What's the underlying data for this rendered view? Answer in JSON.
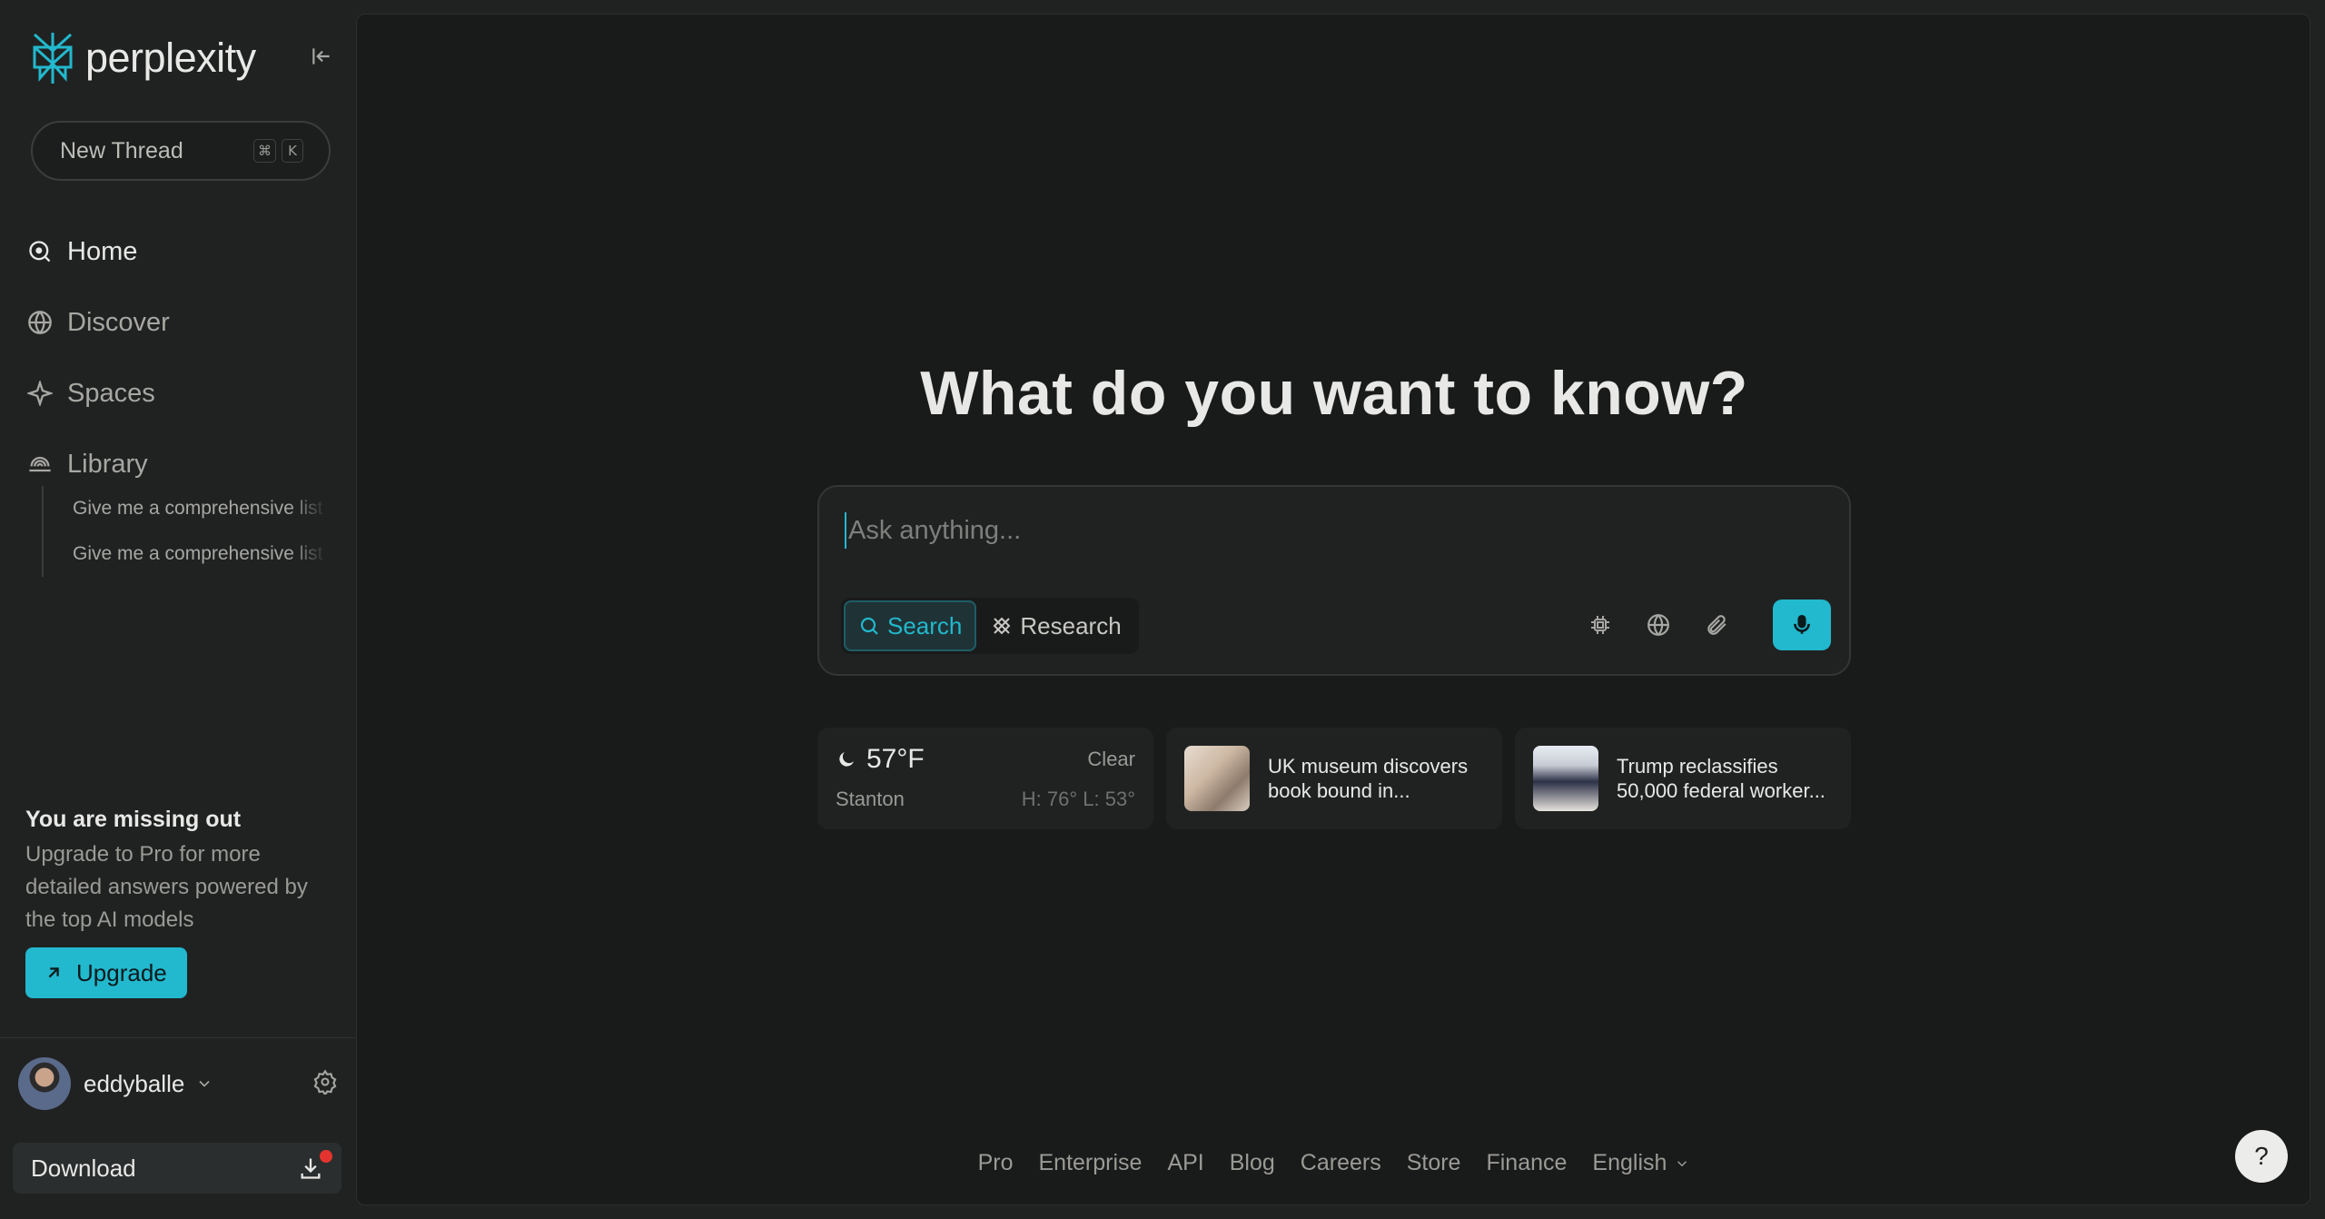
{
  "brand": {
    "name": "perplexity",
    "accent": "#22b8cd"
  },
  "sidebar": {
    "new_thread": {
      "label": "New Thread",
      "shortcut": [
        "⌘",
        "K"
      ]
    },
    "nav": [
      {
        "label": "Home",
        "icon": "search-icon",
        "active": true
      },
      {
        "label": "Discover",
        "icon": "globe-icon"
      },
      {
        "label": "Spaces",
        "icon": "sparkle-icon"
      },
      {
        "label": "Library",
        "icon": "library-icon"
      }
    ],
    "library_items": [
      "Give me a comprehensive list",
      "Give me a comprehensive list"
    ],
    "promo": {
      "title": "You are missing out",
      "text": "Upgrade to Pro for more detailed answers powered by the top AI models",
      "button": "Upgrade"
    },
    "user": {
      "name": "eddyballe"
    },
    "download": {
      "label": "Download"
    }
  },
  "main": {
    "headline": "What do you want to know?",
    "search": {
      "placeholder": "Ask anything...",
      "modes": [
        {
          "label": "Search",
          "icon": "search-icon",
          "active": true
        },
        {
          "label": "Research",
          "icon": "research-icon"
        }
      ],
      "tools": [
        "chip-icon",
        "globe-icon",
        "paperclip-icon",
        "microphone-icon"
      ]
    },
    "weather": {
      "temp": "57°F",
      "condition": "Clear",
      "city": "Stanton",
      "hilo": "H: 76° L: 53°"
    },
    "news": [
      {
        "title": "UK museum discovers book bound in..."
      },
      {
        "title": "Trump reclassifies 50,000 federal worker..."
      }
    ],
    "footer": [
      "Pro",
      "Enterprise",
      "API",
      "Blog",
      "Careers",
      "Store",
      "Finance",
      "English"
    ],
    "help_label": "?"
  }
}
